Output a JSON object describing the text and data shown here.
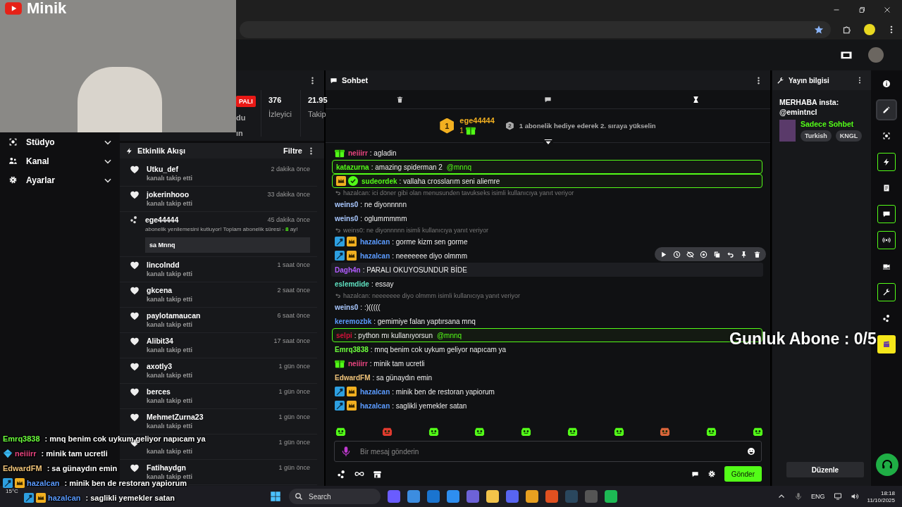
{
  "webcam": {
    "channel_name": "Minik"
  },
  "sidebar": {
    "items": [
      {
        "kind": "studio",
        "label": "Stüdyo",
        "expanded": false
      },
      {
        "kind": "channel",
        "label": "Kanal",
        "expanded": false
      },
      {
        "kind": "settings",
        "label": "Ayarlar",
        "expanded": false
      }
    ]
  },
  "stats": {
    "status": "PALI",
    "fragments": [
      "du",
      "ın"
    ],
    "items": [
      {
        "value": "376",
        "label": "İzleyici"
      },
      {
        "value": "21.95",
        "label": "Takip"
      }
    ]
  },
  "activity": {
    "title": "Etkinlik Akışı",
    "filter": "Filtre",
    "items": [
      {
        "kind": "follow",
        "user": "Utku_def",
        "time": "2 dakika önce",
        "action": "kanalı takip etti"
      },
      {
        "kind": "follow",
        "user": "jokerinhooo",
        "time": "33 dakika önce",
        "action": "kanalı takip etti"
      },
      {
        "kind": "resub",
        "user": "ege44444",
        "time": "45 dakika önce",
        "action": "abonelik yenilemesini kutluyor! Toplam abonelik süresi - **8** ay!",
        "message": "sa Mnnq"
      },
      {
        "kind": "follow",
        "user": "lincolndd",
        "time": "1 saat önce",
        "action": "kanalı takip etti"
      },
      {
        "kind": "follow",
        "user": "gkcena",
        "time": "2 saat önce",
        "action": "kanalı takip etti"
      },
      {
        "kind": "follow",
        "user": "paylotamaucan",
        "time": "6 saat önce",
        "action": "kanalı takip etti"
      },
      {
        "kind": "follow",
        "user": "Alibit34",
        "time": "17 saat önce",
        "action": "kanalı takip etti"
      },
      {
        "kind": "follow",
        "user": "axotly3",
        "time": "1 gün önce",
        "action": "kanalı takip etti"
      },
      {
        "kind": "follow",
        "user": "berces",
        "time": "1 gün önce",
        "action": "kanalı takip etti"
      },
      {
        "kind": "follow",
        "user": "MehmetZurna23",
        "time": "1 gün önce",
        "action": "kanalı takip etti"
      },
      {
        "kind": "follow",
        "time": "1 gün önce",
        "action": "kanalı takip etti"
      },
      {
        "kind": "follow",
        "user": "Fatihaydgn",
        "time": "1 gün önce",
        "action": "kanalı takip etti"
      }
    ]
  },
  "chat": {
    "title": "Sohbet",
    "leaderboard": {
      "rank": "1",
      "user": "ege44444",
      "count": "1",
      "next_rank": "2",
      "next_text": "1 abonelik hediye ederek 2. sıraya yükselin"
    },
    "messages": [
      {
        "kind": "message",
        "badges": [
          {
            "kind": "gift"
          }
        ],
        "user": "neiiirr",
        "color": "#e8457f",
        "text": ": agladin"
      },
      {
        "kind": "highlight",
        "user": "katazurna",
        "color": "#53fc18",
        "text": ": amazing spiderman 2",
        "mention": "@mnnq"
      },
      {
        "kind": "highlight",
        "badges": [
          {
            "kind": "crown"
          },
          {
            "kind": "verified"
          }
        ],
        "user": "sudeordek",
        "color": "#53fc18",
        "text": ": vallaha crosslarım seni aliemre"
      },
      {
        "kind": "reply",
        "text": "hazalcan: ici döner gibi olan menusunden tavukseks isimli kullanıcıya yanıt veriyor"
      },
      {
        "kind": "message",
        "user": "weins0",
        "color": "#a9c8ff",
        "text": ": ne diyonnnnn"
      },
      {
        "kind": "message",
        "user": "weins0",
        "color": "#a9c8ff",
        "text": ": oglummmmm"
      },
      {
        "kind": "reply",
        "text": "weins0: ne diyonnnnn isimli kullanıcıya yanıt veriyor"
      },
      {
        "kind": "message",
        "badges": [
          {
            "kind": "mod"
          },
          {
            "kind": "crown"
          }
        ],
        "user": "hazalcan",
        "color": "#5b9bff",
        "text": ": gorme kizm sen gorme"
      },
      {
        "kind": "message",
        "badges": [
          {
            "kind": "mod"
          },
          {
            "kind": "crown"
          }
        ],
        "user": "hazalcan",
        "color": "#5b9bff",
        "text": ": neeeeeee diyo olmmm"
      },
      {
        "kind": "hovered",
        "user": "Dagh4n",
        "color": "#b15cff",
        "text": ": PARALI OKUYOSUNDUR BİDE"
      },
      {
        "kind": "message",
        "user": "eslemdide",
        "color": "#5fe0c0",
        "text": ": essay"
      },
      {
        "kind": "reply",
        "text": "hazalcan: neeeeeee diyo olmmm isimli kullanıcıya yanıt veriyor"
      },
      {
        "kind": "message",
        "user": "weins0",
        "color": "#a9c8ff",
        "text": ": :)((((("
      },
      {
        "kind": "message",
        "user": "keremozbk",
        "color": "#5b9bff",
        "text": ": gemimiye falan yaptırsana mnq"
      },
      {
        "kind": "highlight",
        "user": "selpi",
        "color": "#d0103a",
        "text": ": python mı kullanıyorsun",
        "mention": "@mnnq"
      },
      {
        "kind": "message",
        "user": "Emrq3838",
        "color": "#6cff3c",
        "text": ": mnq benim cok uykum geliyor napıcam ya"
      },
      {
        "kind": "message",
        "badges": [
          {
            "kind": "gift"
          }
        ],
        "user": "neiiirr",
        "color": "#e8457f",
        "text": ": minik tam ucretli"
      },
      {
        "kind": "message",
        "user": "EdwardFM",
        "color": "#f0c47a",
        "text": ": sa günaydın emin"
      },
      {
        "kind": "message",
        "badges": [
          {
            "kind": "mod"
          },
          {
            "kind": "crown"
          }
        ],
        "user": "hazalcan",
        "color": "#5b9bff",
        "text": ": minik ben de restoran yapiorum"
      },
      {
        "kind": "message",
        "badges": [
          {
            "kind": "mod"
          },
          {
            "kind": "crown"
          }
        ],
        "user": "hazalcan",
        "color": "#5b9bff",
        "text": ": saglikli yemekler satan"
      }
    ],
    "input": {
      "placeholder": "Bir mesaj gönderin"
    },
    "send": "Gönder"
  },
  "stream_info": {
    "title": "Yayın bilgisi",
    "stream_title": "MERHABA insta: @emintncl",
    "category": "Sadece Sohbet",
    "tags": [
      "Turkish",
      "KNGL"
    ],
    "edit": "Düzenle"
  },
  "rail": [
    {
      "kind": "info",
      "selected": false,
      "outlined": false
    },
    {
      "kind": "pencil",
      "selected": true,
      "outlined": false
    },
    {
      "kind": "frame",
      "selected": false,
      "outlined": false
    },
    {
      "kind": "bolt",
      "selected": false,
      "outlined": true
    },
    {
      "kind": "doc",
      "selected": false,
      "outlined": false
    },
    {
      "kind": "chat",
      "selected": false,
      "outlined": true
    },
    {
      "kind": "broadcast",
      "selected": false,
      "outlined": true
    },
    {
      "kind": "camera",
      "selected": false,
      "outlined": false
    },
    {
      "kind": "wrench",
      "selected": false,
      "outlined": true
    },
    {
      "kind": "nodes",
      "selected": false,
      "outlined": false
    },
    {
      "kind": "clapper",
      "selected": false,
      "outlined": false
    }
  ],
  "sub_goal": "Gunluk Abone : 0/5",
  "overlay_chat": [
    {
      "user": "Emrq3838",
      "color": "#6cff3c",
      "text": ": mnq benim cok uykum geliyor napıcam ya"
    },
    {
      "badges": [
        {
          "kind": "sub"
        }
      ],
      "user": "neiiirr",
      "color": "#e8457f",
      "text": ": minik tam ucretli"
    },
    {
      "user": "EdwardFM",
      "color": "#f0c47a",
      "text": ": sa günaydın emin"
    },
    {
      "badges": [
        {
          "kind": "mod"
        },
        {
          "kind": "crown"
        }
      ],
      "user": "hazalcan",
      "color": "#5b9bff",
      "text": ": minik ben de restoran yapiorum"
    },
    {
      "badges": [
        {
          "kind": "mod"
        },
        {
          "kind": "crown"
        }
      ],
      "user": "hazalcan",
      "color": "#5b9bff",
      "text": ": saglikli yemekler satan"
    }
  ],
  "taskbar": {
    "weather": "15°C",
    "search": "Search",
    "language": "ENG",
    "time": "18:18",
    "date": "11/10/2025"
  }
}
